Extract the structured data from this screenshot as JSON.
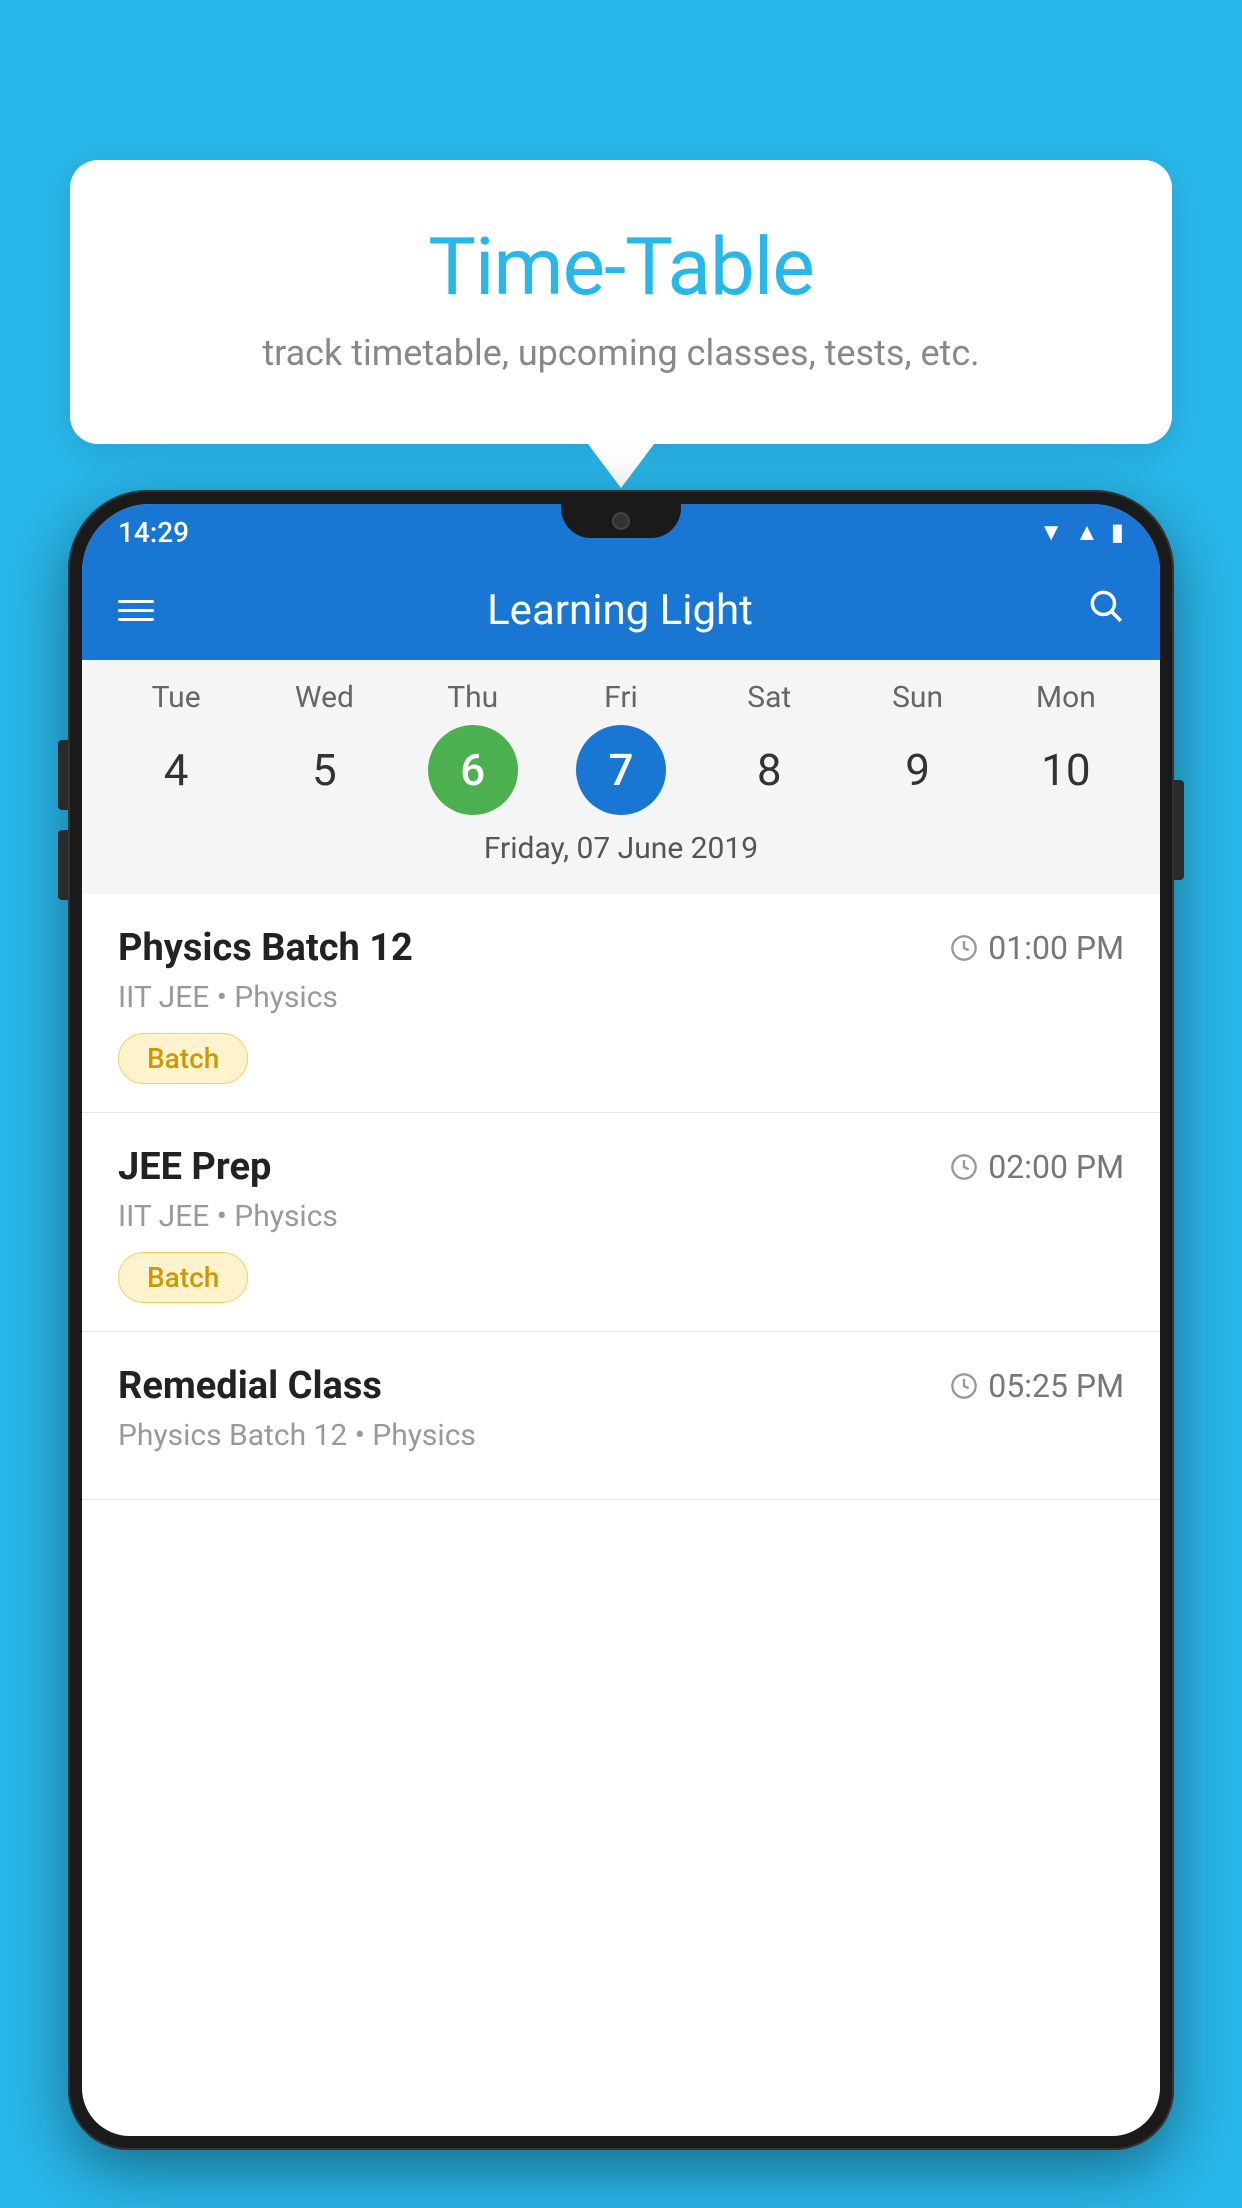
{
  "background_color": "#29b6e8",
  "tooltip": {
    "title": "Time-Table",
    "subtitle": "track timetable, upcoming classes, tests, etc."
  },
  "phone": {
    "status_bar": {
      "time": "14:29"
    },
    "app_bar": {
      "title": "Learning Light"
    },
    "calendar": {
      "days": [
        "Tue",
        "Wed",
        "Thu",
        "Fri",
        "Sat",
        "Sun",
        "Mon"
      ],
      "dates": [
        "4",
        "5",
        "6",
        "7",
        "8",
        "9",
        "10"
      ],
      "today_index": 2,
      "selected_index": 3,
      "selected_label": "Friday, 07 June 2019"
    },
    "schedule": [
      {
        "title": "Physics Batch 12",
        "time": "01:00 PM",
        "subtitle": "IIT JEE • Physics",
        "badge": "Batch"
      },
      {
        "title": "JEE Prep",
        "time": "02:00 PM",
        "subtitle": "IIT JEE • Physics",
        "badge": "Batch"
      },
      {
        "title": "Remedial Class",
        "time": "05:25 PM",
        "subtitle": "Physics Batch 12 • Physics",
        "badge": null
      }
    ]
  }
}
